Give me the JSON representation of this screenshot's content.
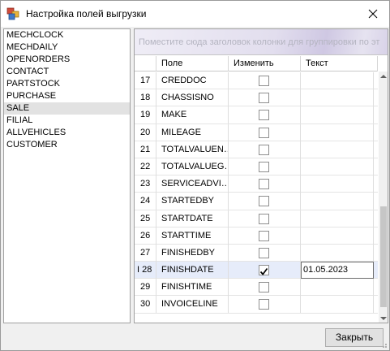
{
  "window": {
    "title": "Настройка полей выгрузки",
    "close_icon": "close-icon",
    "app_icon": "window-app-icon"
  },
  "sources": {
    "items": [
      "MECHCLOCK",
      "MECHDAILY",
      "OPENORDERS",
      "CONTACT",
      "PARTSTOCK",
      "PURCHASE",
      "SALE",
      "FILIAL",
      "ALLVEHICLES",
      "CUSTOMER"
    ],
    "selected": "SALE"
  },
  "grid": {
    "group_panel_text": "Поместите сюда заголовок колонки для группировки по эт",
    "columns": [
      "Поле",
      "Изменить",
      "Текст"
    ],
    "rows": [
      {
        "num": "17",
        "field": "CREDDOC",
        "checked": false,
        "text": ""
      },
      {
        "num": "18",
        "field": "CHASSISNO",
        "checked": false,
        "text": ""
      },
      {
        "num": "19",
        "field": "MAKE",
        "checked": false,
        "text": ""
      },
      {
        "num": "20",
        "field": "MILEAGE",
        "checked": false,
        "text": ""
      },
      {
        "num": "21",
        "field": "TOTALVALUEN…",
        "checked": false,
        "text": ""
      },
      {
        "num": "22",
        "field": "TOTALVALUEG…",
        "checked": false,
        "text": ""
      },
      {
        "num": "23",
        "field": "SERVICEADVI…",
        "checked": false,
        "text": ""
      },
      {
        "num": "24",
        "field": "STARTEDBY",
        "checked": false,
        "text": ""
      },
      {
        "num": "25",
        "field": "STARTDATE",
        "checked": false,
        "text": ""
      },
      {
        "num": "26",
        "field": "STARTTIME",
        "checked": false,
        "text": ""
      },
      {
        "num": "27",
        "field": "FINISHEDBY",
        "checked": false,
        "text": ""
      },
      {
        "num": "28",
        "field": "FINISHDATE",
        "checked": true,
        "text": "01.05.2023",
        "current": true
      },
      {
        "num": "29",
        "field": "FINISHTIME",
        "checked": false,
        "text": ""
      },
      {
        "num": "30",
        "field": "INVOICELINE",
        "checked": false,
        "text": ""
      }
    ]
  },
  "footer": {
    "close_label": "Закрыть"
  }
}
